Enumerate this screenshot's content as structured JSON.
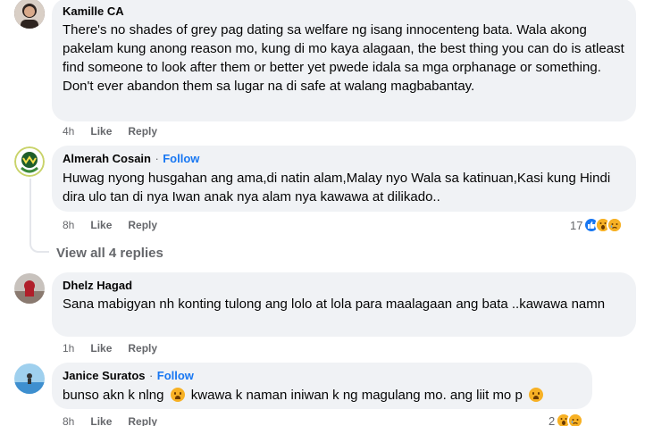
{
  "comments": [
    {
      "author": "Kamille CA",
      "text": "There's no shades of grey pag dating sa welfare ng isang innocenteng bata. Wala akong pakelam kung anong reason mo, kung di mo kaya alagaan, the best thing you can do is atleast find someone to look after them or better yet pwede idala sa mga orphanage or something. Don't ever abandon them sa lugar na di safe at walang magbabantay.",
      "time": "4h",
      "like": "Like",
      "reply": "Reply"
    },
    {
      "author": "Almerah Cosain",
      "separator": "·",
      "follow": "Follow",
      "text": "Huwag nyong husgahan ang ama,di natin alam,Malay nyo Wala sa katinuan,Kasi kung Hindi dira ulo tan di nya Iwan anak nya alam nya kawawa at dilikado..",
      "time": "8h",
      "like": "Like",
      "reply": "Reply",
      "reaction_count": "17",
      "reactions": [
        "like-icon",
        "wow-icon",
        "sad-icon"
      ]
    },
    {
      "author": "Dhelz Hagad",
      "text": "Sana mabigyan nh konting tulong ang lolo at lola para maalagaan ang bata ..kawawa namn",
      "time": "1h",
      "like": "Like",
      "reply": "Reply"
    },
    {
      "author": "Janice Suratos",
      "separator": "·",
      "follow": "Follow",
      "text_a": "bunso akn k nlng",
      "text_b": "kwawa k naman iniwan k ng magulang mo. ang liit mo p",
      "time": "8h",
      "like": "Like",
      "reply": "Reply",
      "reaction_count": "2",
      "reactions": [
        "wow-icon",
        "sad-icon"
      ]
    }
  ],
  "view_replies": "View all 4 replies",
  "colors": {
    "bubble": "#f0f2f5",
    "link": "#1877f2",
    "muted": "#65676b"
  }
}
